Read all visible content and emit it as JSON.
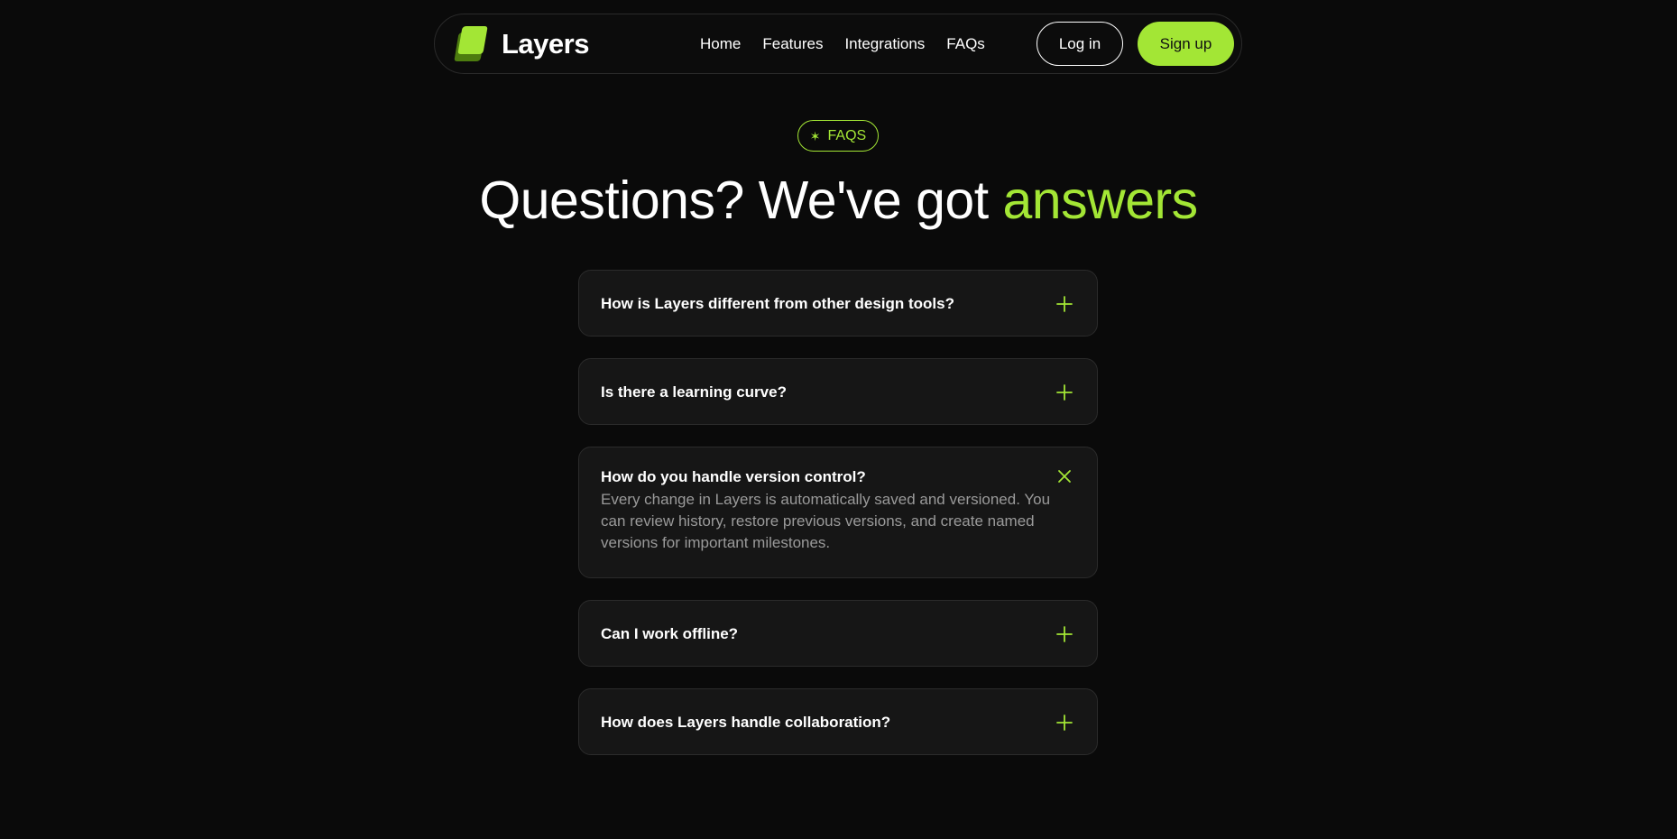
{
  "brand": {
    "name": "Layers",
    "accent_color": "#a3e635",
    "logo_icon": "layers-logo-icon"
  },
  "nav": {
    "links": [
      "Home",
      "Features",
      "Integrations",
      "FAQs"
    ],
    "login_label": "Log in",
    "signup_label": "Sign up"
  },
  "section": {
    "badge_icon": "✶",
    "badge_label": "FAQS",
    "title_main": "Questions? We've got ",
    "title_accent": "answers"
  },
  "faqs": [
    {
      "question": "How is Layers different from other design tools?",
      "answer": "",
      "open": false,
      "toggle_icon": "plus-icon"
    },
    {
      "question": "Is there a learning curve?",
      "answer": "",
      "open": false,
      "toggle_icon": "plus-icon"
    },
    {
      "question": "How do you handle version control?",
      "answer": "Every change in Layers is automatically saved and versioned. You can review history, restore previous versions, and create named versions for important milestones.",
      "open": true,
      "toggle_icon": "close-icon"
    },
    {
      "question": "Can I work offline?",
      "answer": "",
      "open": false,
      "toggle_icon": "plus-icon"
    },
    {
      "question": "How does Layers handle collaboration?",
      "answer": "",
      "open": false,
      "toggle_icon": "plus-icon"
    }
  ]
}
